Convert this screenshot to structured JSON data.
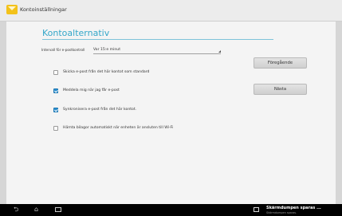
{
  "app": {
    "title": "Kontoinställningar"
  },
  "page": {
    "heading": "Kontoalternativ"
  },
  "interval": {
    "label": "Intervall för e-postkontroll",
    "value": "Var 15:e minut"
  },
  "buttons": {
    "previous": "Föregående",
    "next": "Nästa"
  },
  "options": [
    {
      "label": "Skicka e-post från det här kontot som standard",
      "checked": false
    },
    {
      "label": "Meddela mig när jag får e-post",
      "checked": true
    },
    {
      "label": "Synkronisera e-post från det här kontot.",
      "checked": true
    },
    {
      "label": "Hämta bilagor automatiskt när enheten är ansluten till Wi-Fi",
      "checked": false
    }
  ],
  "notification": {
    "title": "Skärmdumpen sparas ...",
    "subtitle": "Skärmdumpen sparas."
  },
  "icons": {
    "back": "back-icon",
    "home": "home-icon",
    "recent": "recent-apps-icon",
    "notification": "screenshot-icon"
  },
  "colors": {
    "accent": "#34a7c9",
    "checkbox": "#2b8fd0"
  }
}
